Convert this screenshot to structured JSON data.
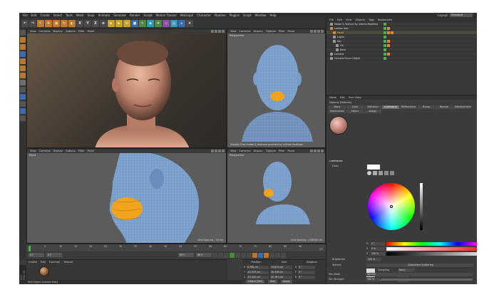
{
  "menubar": {
    "items": [
      "File",
      "Edit",
      "Create",
      "Select",
      "Tools",
      "Mesh",
      "Snap",
      "Animate",
      "Simulate",
      "Render",
      "Sculpt",
      "Motion Tracker",
      "MoGraph",
      "Character",
      "Pipeline",
      "Plugins",
      "Script",
      "Window",
      "Help"
    ],
    "layout_label": "Layout:",
    "layout_value": "Standard"
  },
  "toolbar": {
    "axis_x": "X",
    "axis_y": "Y",
    "axis_z": "Z"
  },
  "viewports": {
    "top_left": {
      "menus": [
        "View",
        "Cameras",
        "Display",
        "Options",
        "Filter",
        "Panel"
      ]
    },
    "top_right": {
      "menus": [
        "View",
        "Cameras",
        "Display",
        "Options",
        "Filter",
        "Panel"
      ],
      "label": "Perspective",
      "info": "Visually Free model & textures provided by Infinite-Realities"
    },
    "bottom_left": {
      "menus": [
        "View",
        "Cameras",
        "Display",
        "Options",
        "Filter",
        "Panel"
      ],
      "label": "Right",
      "info": "Grid Spacing : 10 cm"
    },
    "bottom_right": {
      "menus": [
        "View",
        "Cameras",
        "Display",
        "Options",
        "Filter",
        "Panel"
      ],
      "label": "Perspective",
      "info": "Grid Spacing : 100000 cm"
    }
  },
  "timeline": {
    "ticks": [
      "0",
      "5",
      "10",
      "15",
      "20",
      "25",
      "30",
      "35",
      "40",
      "45",
      "50",
      "55",
      "60",
      "65",
      "70",
      "75",
      "80",
      "85",
      "90"
    ],
    "end_label": "0 F"
  },
  "transport": {
    "start": "0 F",
    "current": "0 F",
    "end": "90 F",
    "end2": "90 F"
  },
  "material_manager": {
    "menus": [
      "Create",
      "Edit",
      "Function",
      "Texture"
    ],
    "logo": "MAXON CINEMA 4D"
  },
  "coordinates": {
    "headers": [
      "Position",
      "Size",
      "Rotation"
    ],
    "rows": [
      {
        "axis": "X",
        "pos": "0.788 cm",
        "size": "70.613 cm",
        "rot_axis": "H",
        "rot": "0 °"
      },
      {
        "axis": "Y",
        "pos": "-61.533 cm",
        "size": "39.328 cm",
        "rot_axis": "P",
        "rot": "0 °"
      },
      {
        "axis": "Z",
        "pos": "-97.441 cm",
        "size": "50.767 cm",
        "rot_axis": "B",
        "rot": "0 °"
      }
    ],
    "mode": "Object (Rel)",
    "size_mode": "Size",
    "apply": "Apply"
  },
  "status": "Null Object [Lashes Hair]",
  "object_manager": {
    "menus": [
      "File",
      "Edit",
      "View",
      "Objects",
      "Tags",
      "Bookmarks"
    ],
    "objects": [
      {
        "name": "Model & Texture By Infinite-Realities"
      },
      {
        "name": "Lashes Hair"
      },
      {
        "name": "Head"
      },
      {
        "name": "Lights"
      },
      {
        "name": "Key"
      },
      {
        "name": "Fill"
      },
      {
        "name": "Back"
      },
      {
        "name": "Camera"
      },
      {
        "name": "Camera Focus Object"
      }
    ]
  },
  "attributes": {
    "menus": [
      "Mode",
      "Edit",
      "User Data"
    ],
    "material_title": "Material [Material]",
    "tabs": [
      "Basic",
      "Color",
      "Diffusion",
      "Luminance",
      "Reflectance",
      "Bump",
      "Normal",
      "Displacement",
      "Illumination",
      "Editor",
      "Assign"
    ],
    "active_tab": "Luminance",
    "section": "Luminance",
    "color_label": "Color",
    "h_label": "H",
    "h_value": "0 °",
    "s_label": "S",
    "s_value": "0 %",
    "v_label": "V",
    "v_value": "100 %",
    "brightness_label": "Brightness",
    "brightness_value": "100 %",
    "texture_label": "Texture",
    "texture_value": "Subsurface Scattering",
    "sampling_label": "Sampling",
    "sampling_value": "None",
    "blur_offset_label": "Blur Offset",
    "blur_offset_value": "0 %",
    "blur_scale_label": "Blur Scale",
    "blur_scale_value": "0 %",
    "mix_mode_label": "Mix Mode",
    "mix_mode_value": "Normal",
    "mix_strength_label": "Mix Strength",
    "mix_strength_value": "100 %"
  },
  "colors": {
    "wire": "#7fb4e6",
    "highlight": "#f0a31c",
    "background": "#3c3c3c"
  }
}
